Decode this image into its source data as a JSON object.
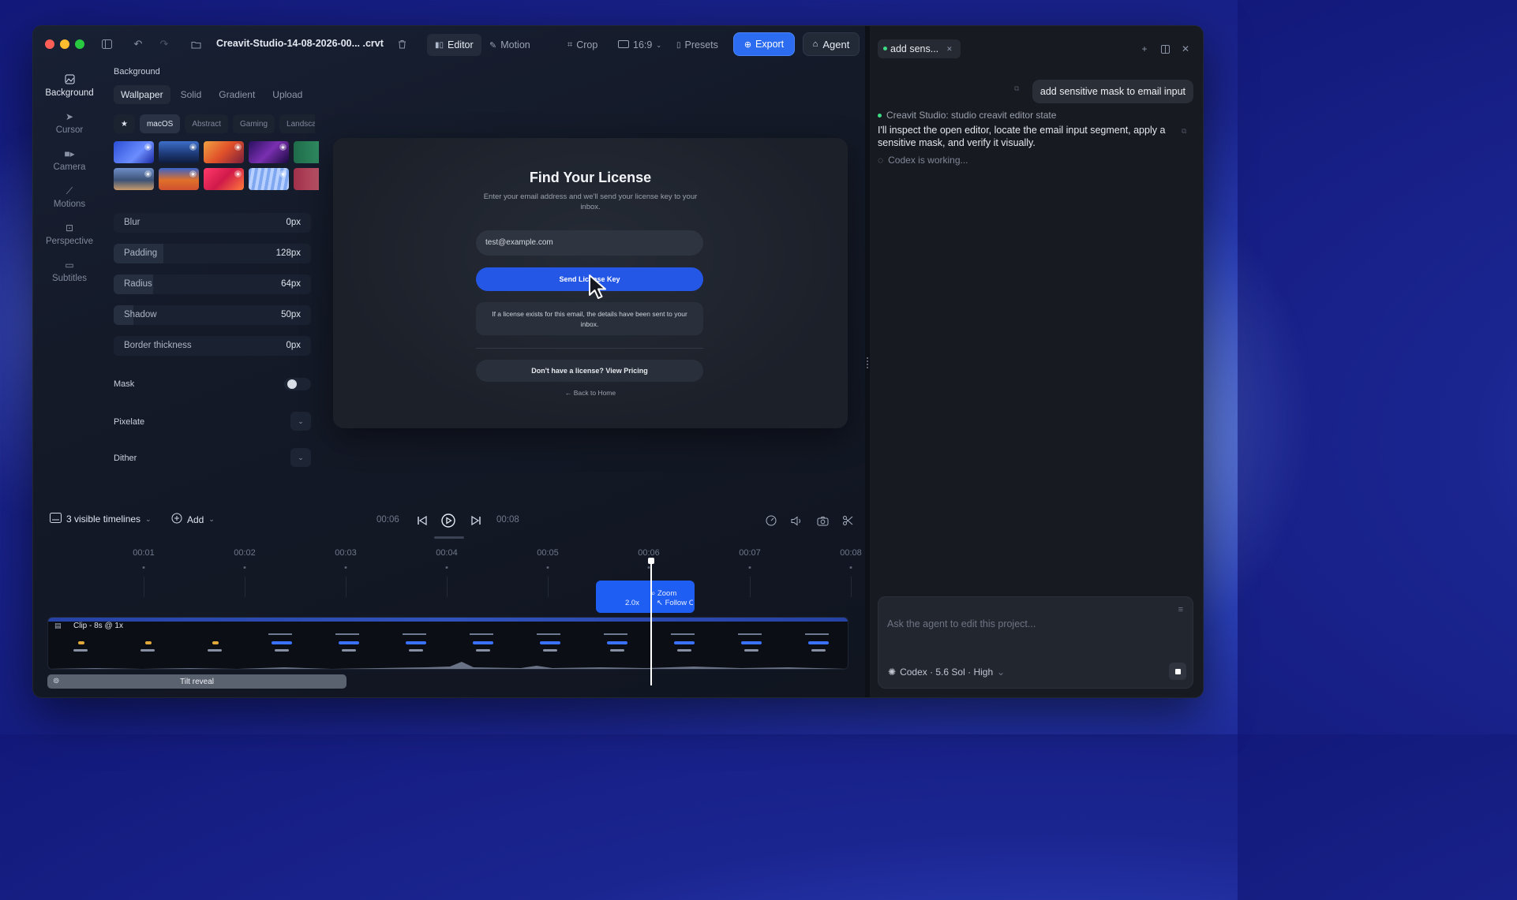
{
  "titlebar": {
    "filename": "Creavit-Studio-14-08-2026-00... .crvt",
    "modes": [
      {
        "label": "Editor",
        "active": true
      },
      {
        "label": "Motion",
        "active": false
      }
    ],
    "crop_label": "Crop",
    "aspect_label": "16:9",
    "presets_label": "Presets",
    "export_label": "Export",
    "agent_label": "Agent"
  },
  "rail": [
    {
      "label": "Background",
      "icon": "image-icon",
      "active": true
    },
    {
      "label": "Cursor",
      "icon": "pointer-icon",
      "active": false
    },
    {
      "label": "Camera",
      "icon": "camera-icon",
      "active": false
    },
    {
      "label": "Motions",
      "icon": "motion-path-icon",
      "active": false
    },
    {
      "label": "Perspective",
      "icon": "perspective-icon",
      "active": false
    },
    {
      "label": "Subtitles",
      "icon": "subtitles-icon",
      "active": false
    }
  ],
  "panel": {
    "section_title": "Background",
    "tabs": [
      "Wallpaper",
      "Solid",
      "Gradient",
      "Upload"
    ],
    "active_tab": "Wallpaper",
    "categories": [
      "macOS",
      "Abstract",
      "Gaming",
      "Landscape"
    ],
    "active_category": "macOS",
    "sliders": [
      {
        "label": "Blur",
        "value": "0px",
        "fill": 0
      },
      {
        "label": "Padding",
        "value": "128px",
        "fill": 0.25
      },
      {
        "label": "Radius",
        "value": "64px",
        "fill": 0.2
      },
      {
        "label": "Shadow",
        "value": "50px",
        "fill": 0.1
      },
      {
        "label": "Border thickness",
        "value": "0px",
        "fill": 0
      }
    ],
    "mask_label": "Mask",
    "mask_on": false,
    "pixelate_label": "Pixelate",
    "dither_label": "Dither"
  },
  "preview": {
    "title": "Find Your License",
    "subtitle": "Enter your email address and we'll send your license key to your inbox.",
    "email_value": "test@example.com",
    "send_button": "Send License Key",
    "notice": "If a license exists for this email, the details have been sent to your inbox.",
    "pricing_button": "Don't have a license? View Pricing",
    "back_link": "← Back to Home"
  },
  "transport": {
    "timelines_label": "3 visible timelines",
    "add_label": "Add",
    "current_time": "00:06",
    "end_time": "00:08"
  },
  "ruler": [
    "00:01",
    "00:02",
    "00:03",
    "00:04",
    "00:05",
    "00:06",
    "00:07",
    "00:08"
  ],
  "timeline": {
    "zoom_title": "Zoom",
    "zoom_factor": "2.0x",
    "zoom_mode": "Follow Cur",
    "clip_label": "Clip - 8s @ 1x",
    "effect_label": "Tilt reveal"
  },
  "agent": {
    "tab_label": "add sens...",
    "user_message": "add sensitive mask to email input",
    "tool_line": "Creavit Studio: studio creavit editor state",
    "assistant_message": "I'll inspect the open editor, locate the email input segment, apply a sensitive mask, and verify it visually.",
    "working_status": "Codex is working...",
    "composer_placeholder": "Ask the agent to edit this project...",
    "model_label": "Codex · 5.6 Sol · High"
  },
  "colors": {
    "accent": "#2b6cf0",
    "zoom_block": "#1f5ef2",
    "status_green": "#3ddc84"
  }
}
